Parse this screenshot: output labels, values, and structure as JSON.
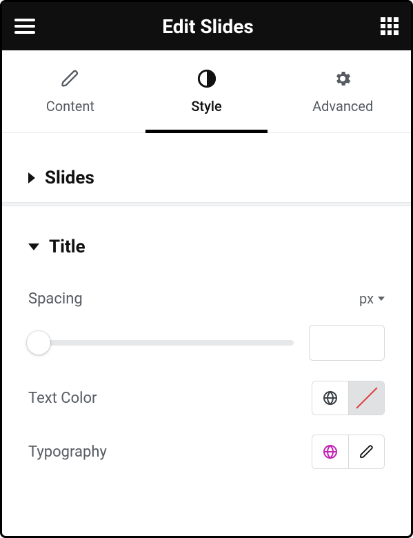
{
  "header": {
    "title": "Edit Slides"
  },
  "tabs": {
    "content": "Content",
    "style": "Style",
    "advanced": "Advanced",
    "active": "style"
  },
  "sections": {
    "slides": {
      "label": "Slides",
      "expanded": false
    },
    "title": {
      "label": "Title",
      "expanded": true
    }
  },
  "controls": {
    "spacing": {
      "label": "Spacing",
      "unit": "px",
      "value": ""
    },
    "text_color": {
      "label": "Text Color"
    },
    "typography": {
      "label": "Typography"
    }
  }
}
